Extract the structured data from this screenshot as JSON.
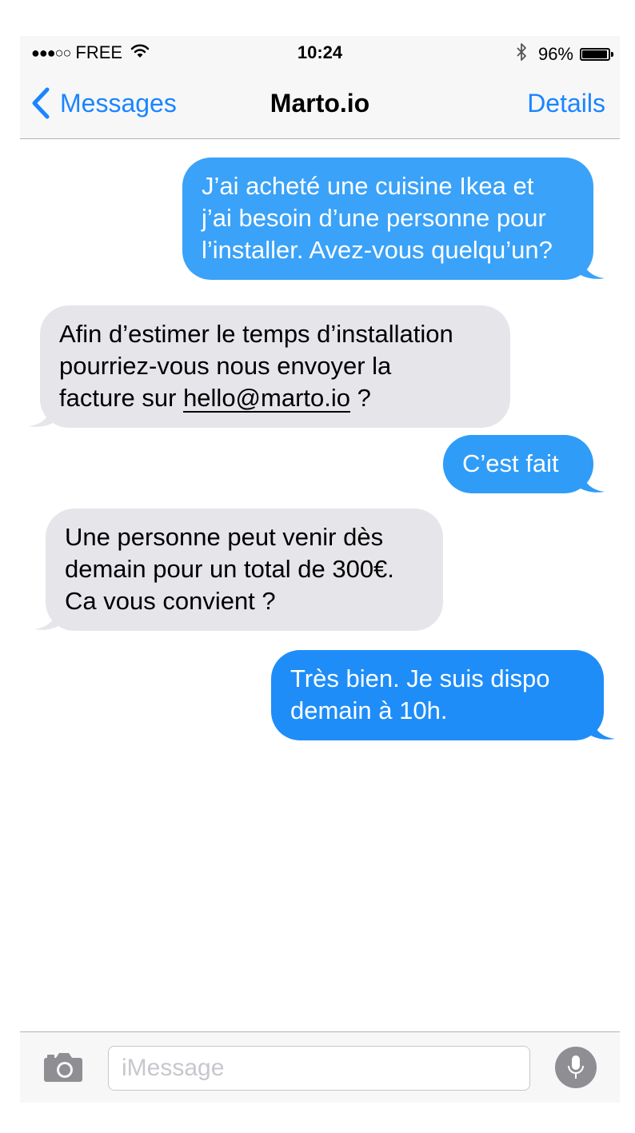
{
  "status_bar": {
    "signal": "●●●○○",
    "carrier": "FREE",
    "time": "10:24",
    "battery_percent": "96%",
    "battery_level": 0.96
  },
  "nav": {
    "back_label": "Messages",
    "title": "Marto.io",
    "details_label": "Details"
  },
  "messages": [
    {
      "direction": "outgoing",
      "lines": [
        "J’ai acheté une cuisine Ikea et",
        "j’ai besoin d’une personne pour",
        "l’installer. Avez-vous quelqu’un?"
      ]
    },
    {
      "direction": "incoming",
      "lines": [
        "Afin d’estimer le temps d’installation",
        "pourriez-vous nous envoyer la"
      ],
      "last_prefix": "facture sur ",
      "link": "hello@marto.io",
      "last_suffix": " ?"
    },
    {
      "direction": "outgoing",
      "lines": [
        "C’est fait"
      ]
    },
    {
      "direction": "incoming",
      "lines": [
        "Une personne peut venir dès",
        "demain pour un total de 300€.",
        "Ca vous convient ?"
      ]
    },
    {
      "direction": "outgoing",
      "lines": [
        "Très bien. Je suis dispo",
        "demain à 10h."
      ]
    }
  ],
  "input": {
    "placeholder": "iMessage",
    "value": ""
  },
  "colors": {
    "outgoing_top": "#3aa4f9",
    "outgoing_bottom": "#1d8cf8",
    "incoming": "#e5e5ea",
    "accent": "#1a85ff"
  },
  "icons": {
    "back": "chevron-left-icon",
    "camera": "camera-icon",
    "mic": "microphone-icon",
    "bluetooth": "bluetooth-icon",
    "wifi": "wifi-icon",
    "battery": "battery-icon"
  }
}
